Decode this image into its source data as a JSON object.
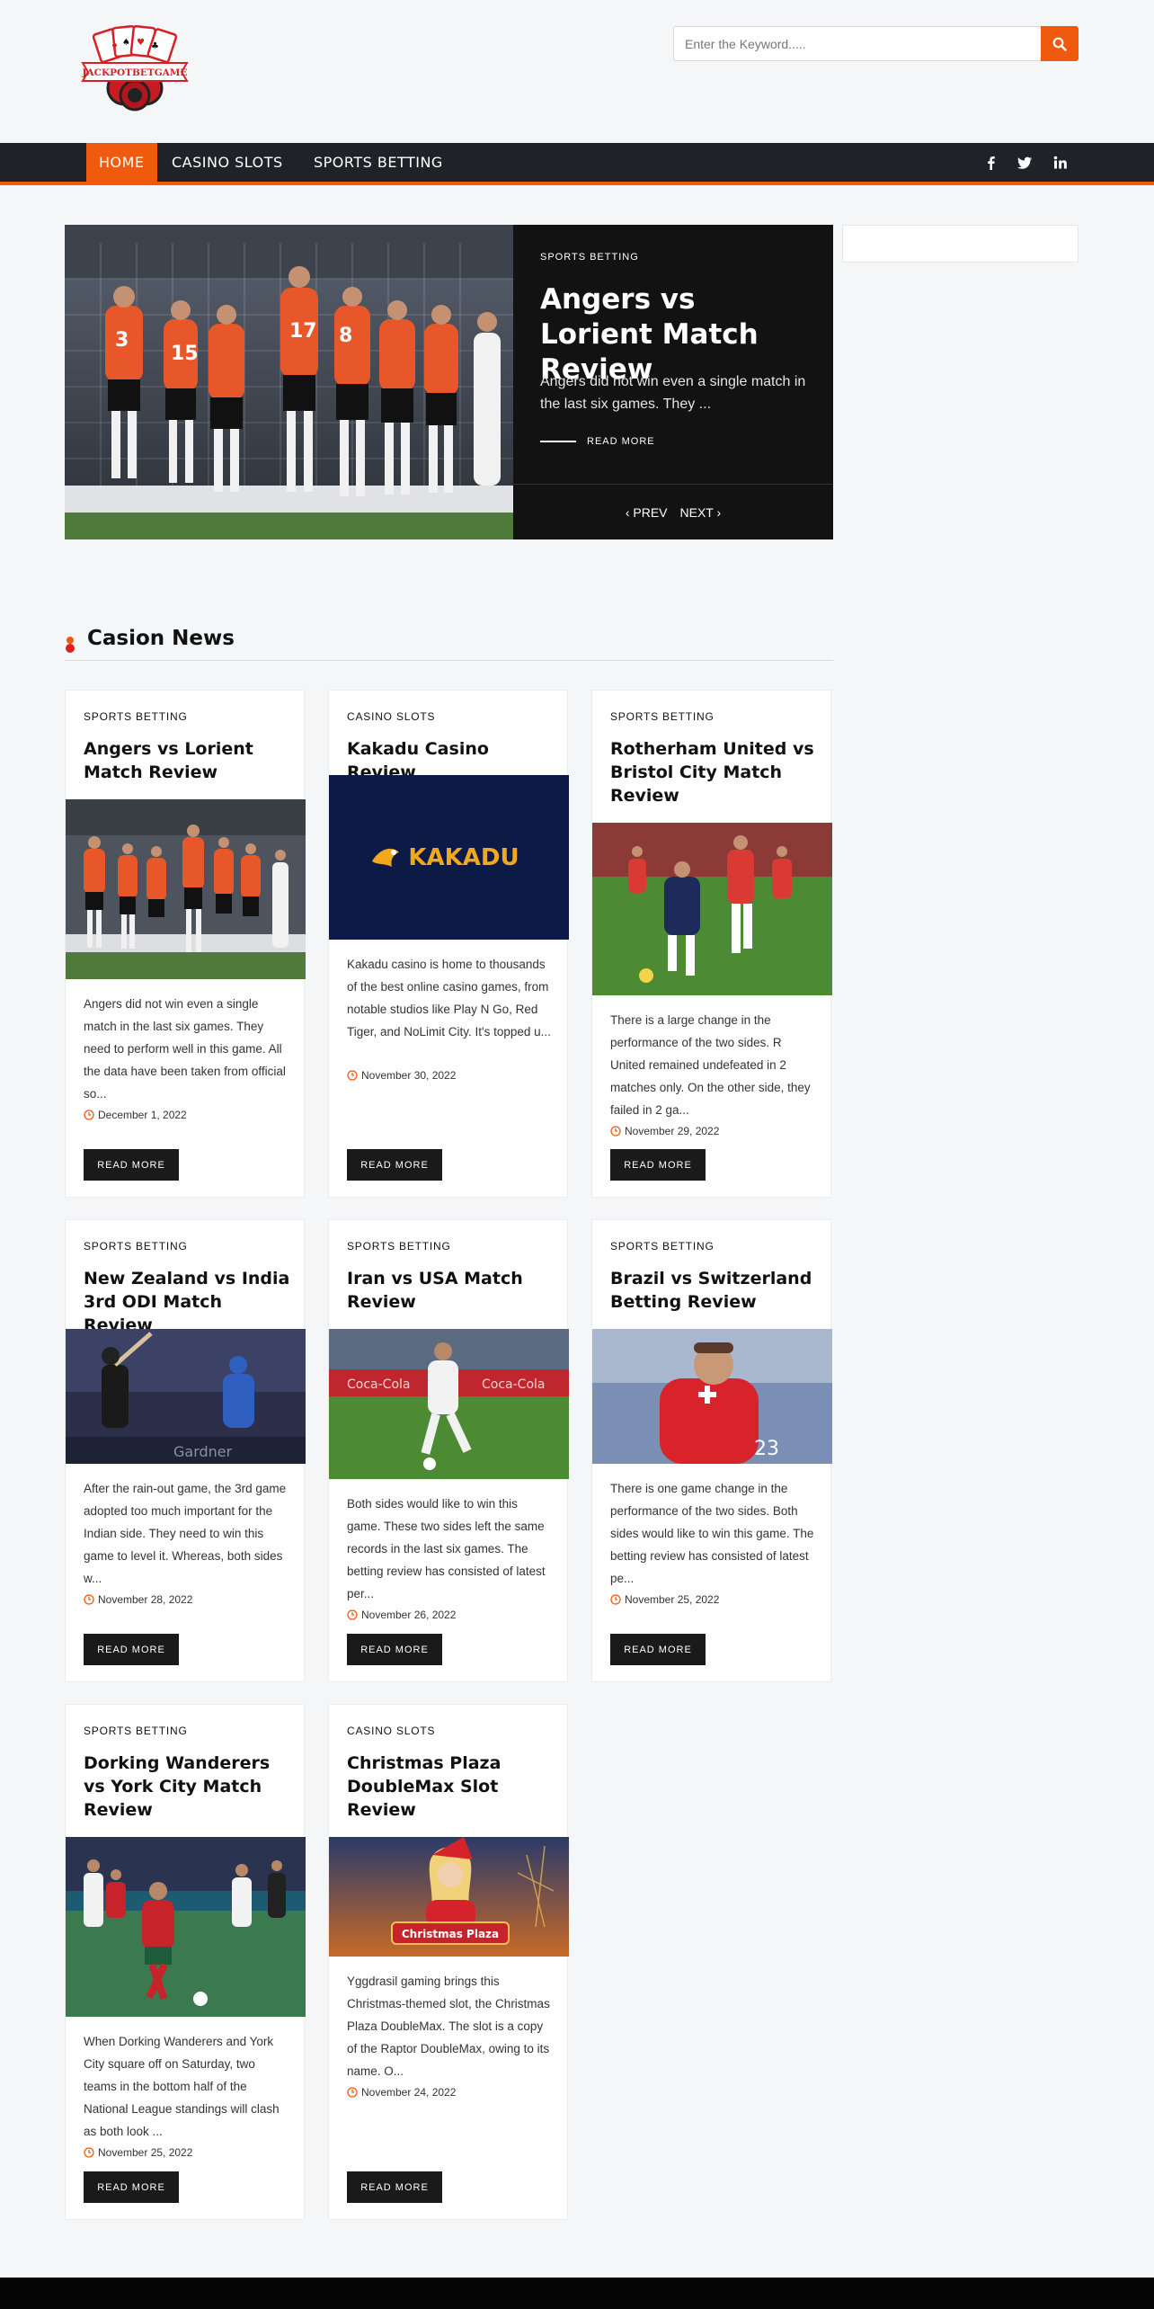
{
  "site": {
    "logo_text": "JACKPOTBETGAME"
  },
  "search": {
    "placeholder": "Enter the Keyword....."
  },
  "nav": {
    "items": [
      "HOME",
      "CASINO SLOTS",
      "SPORTS BETTING"
    ],
    "social": [
      "facebook-icon",
      "twitter-icon",
      "linkedin-icon"
    ]
  },
  "featured": {
    "category": "SPORTS BETTING",
    "title": "Angers vs Lorient Match Review",
    "excerpt": "Angers did not win even a single match in the last six games. They ...",
    "read_more": "READ MORE",
    "prev": "PREV",
    "next": "NEXT"
  },
  "section": {
    "title": "Casion News"
  },
  "posts": [
    {
      "category": "SPORTS BETTING",
      "title": "Angers vs Lorient Match Review",
      "excerpt": "Angers did not win even a single match in the last six games. They need to perform well in this game. All the data have been taken from official so...",
      "date": "December 1, 2022",
      "button": "READ MORE"
    },
    {
      "category": "CASINO SLOTS",
      "title": "Kakadu Casino Review",
      "image_text": "KAKADU",
      "excerpt": "Kakadu casino is home to thousands of the best online casino games, from notable studios like Play N Go, Red Tiger, and NoLimit City. It's topped u...",
      "date": "November 30, 2022",
      "button": "READ MORE"
    },
    {
      "category": "SPORTS BETTING",
      "title": "Rotherham United vs Bristol City Match Review",
      "excerpt": "There is a large change in the performance of the two sides. R United remained undefeated in 2 matches only. On the other side, they failed in 2 ga...",
      "date": "November 29, 2022",
      "button": "READ MORE"
    },
    {
      "category": "SPORTS BETTING",
      "title": "New Zealand vs India 3rd ODI Match Review",
      "excerpt": "After the rain-out game, the 3rd game adopted too much important for the Indian side. They need to win this game to level it. Whereas, both sides w...",
      "date": "November 28, 2022",
      "button": "READ MORE"
    },
    {
      "category": "SPORTS BETTING",
      "title": "Iran vs USA Match Review",
      "excerpt": "Both sides would like to win this game. These two sides left the same records in the last six games. The betting review has consisted of latest per...",
      "date": "November 26, 2022",
      "button": "READ MORE"
    },
    {
      "category": "SPORTS BETTING",
      "title": "Brazil vs Switzerland Betting Review",
      "excerpt": "There is one game change in the performance of the two sides. Both sides would like to win this game. The betting review has consisted of latest pe...",
      "date": "November 25, 2022",
      "button": "READ MORE"
    },
    {
      "category": "SPORTS BETTING",
      "title": "Dorking Wanderers vs York City Match Review",
      "excerpt": "When Dorking Wanderers and York City square off on Saturday, two teams in the bottom half of the National League standings will clash as both look ...",
      "date": "November 25, 2022",
      "button": "READ MORE"
    },
    {
      "category": "CASINO SLOTS",
      "title": "Christmas Plaza DoubleMax Slot Review",
      "image_text": "Christmas Plaza",
      "excerpt": "Yggdrasil gaming brings this Christmas-themed slot, the Christmas Plaza DoubleMax. The slot is a copy of the Raptor DoubleMax, owing to its name. O...",
      "date": "November 24, 2022",
      "button": "READ MORE"
    }
  ],
  "colors": {
    "accent": "#f05a0e",
    "nav_bg": "#1f2328",
    "dark": "#121212"
  }
}
